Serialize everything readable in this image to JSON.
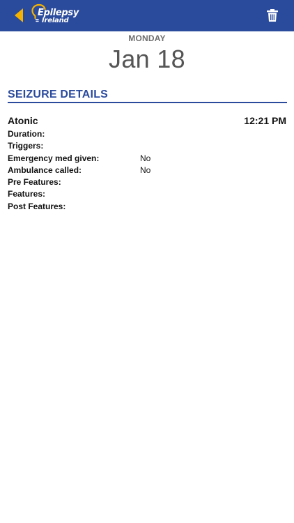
{
  "header": {
    "logo_line1": "Epilepsy",
    "logo_line2": "Ireland",
    "colors": {
      "bar": "#2a4a9c",
      "back_arrow": "#f5b300",
      "logo_accent": "#f5b300"
    },
    "back_icon": "chevron-left-icon",
    "delete_icon": "trash-icon"
  },
  "date": {
    "day": "MONDAY",
    "date": "Jan 18"
  },
  "section": {
    "title": "SEIZURE DETAILS"
  },
  "seizure": {
    "type": "Atonic",
    "time": "12:21 PM",
    "details": [
      {
        "label": "Duration:",
        "value": ""
      },
      {
        "label": "Triggers:",
        "value": ""
      },
      {
        "label": "Emergency med given:",
        "value": "No"
      },
      {
        "label": "Ambulance called:",
        "value": "No"
      },
      {
        "label": "Pre Features:",
        "value": ""
      },
      {
        "label": "Features:",
        "value": ""
      },
      {
        "label": "Post Features:",
        "value": ""
      }
    ]
  }
}
